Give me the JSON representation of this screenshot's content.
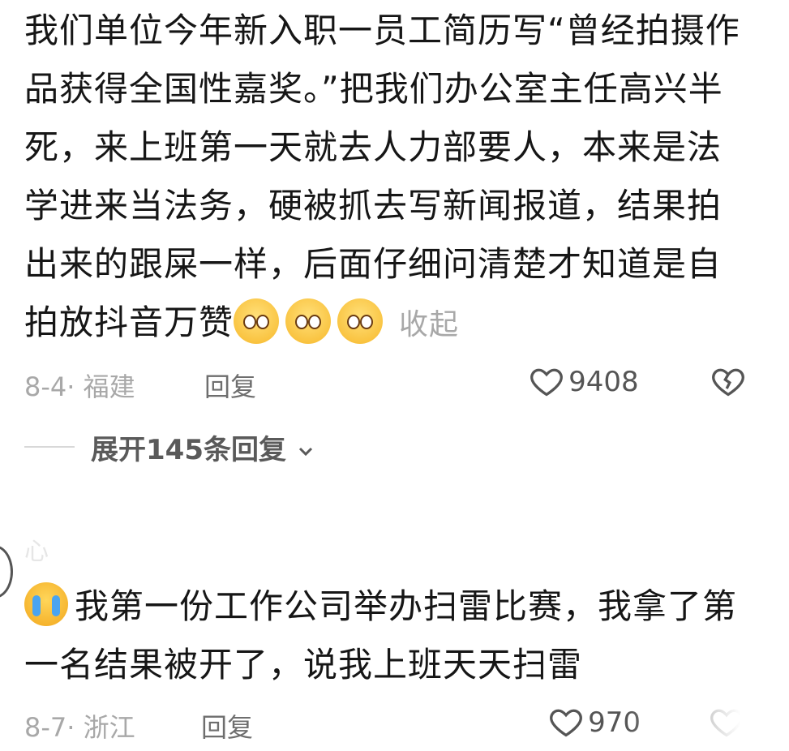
{
  "comments": [
    {
      "text": "我们单位今年新入职一员工简历写“曾经拍摄作品获得全国性嘉奖。”把我们办公室主任高兴半死，来上班第一天就去人力部要人，本来是法学进来当法务，硬被抓去写新闻报道，结果拍出来的跟屎一样，后面仔细问清楚才知道是自拍放抖音万赞",
      "emoji": [
        "pleading-face",
        "pleading-face",
        "pleading-face"
      ],
      "collapse_label": "收起",
      "meta": "8-4· 福建",
      "reply_label": "回复",
      "like_count": "9408"
    },
    {
      "text": "我第一份工作公司举办扫雷比赛，我拿了第一名结果被开了，说我上班天天扫雷",
      "emoji": "loudly-crying-face",
      "meta": "8-7· 浙江",
      "reply_label": "回复",
      "like_count": "970"
    }
  ],
  "expand_replies_label": "展开145条回复",
  "faded_username": "心",
  "colors": {
    "text": "#161616",
    "meta": "#a8a8a8",
    "action": "#6e6e6e"
  }
}
